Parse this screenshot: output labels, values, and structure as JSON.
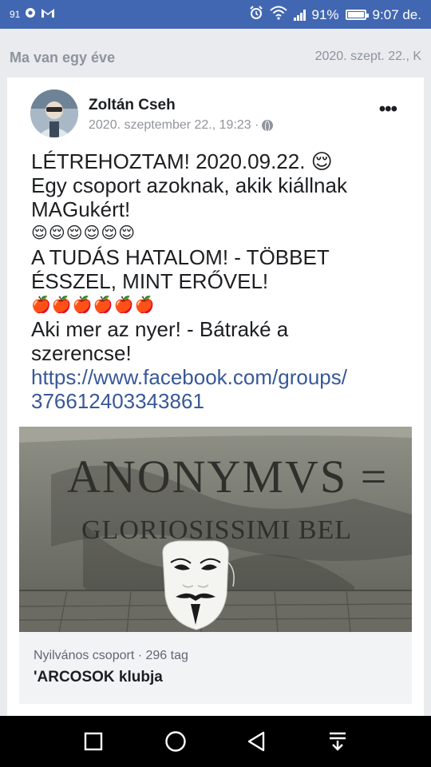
{
  "status_bar": {
    "left_text": "91",
    "battery_percent": "91%",
    "battery_level": 0.91,
    "time": "9:07 de.",
    "icons": [
      "percent-icon",
      "chrome-icon",
      "gmail-icon",
      "alarm-icon",
      "wifi-icon",
      "signal-icon",
      "battery-icon"
    ]
  },
  "memories": {
    "title": "Ma van egy éve",
    "date": "2020. szept. 22., K"
  },
  "post": {
    "author": "Zoltán Cseh",
    "timestamp": "2020. szeptember 22., 19:23 ·",
    "privacy_icon": "globe-icon",
    "lines": [
      "LÉTREHOZTAM! 2020.09.22. 😌",
      "Egy csoport azoknak, akik kiállnak",
      "MAGukért!",
      "😌😌😌😌😌😌",
      "A TUDÁS HATALOM! - TÖBBET",
      "ÉSSZEL, MINT ERŐVEL!",
      "🍎🍎🍎🍎🍎🍎",
      "Aki mer az nyer! - Bátraké a",
      "szerencse!"
    ],
    "link_line1": "https://www.facebook.com/groups/",
    "link_line2": "376612403343861"
  },
  "link_preview": {
    "image_text_line1": "ANONYMVS =",
    "image_text_line2": "GLORIOSISSIMI BEL",
    "subtitle": "Nyilvános csoport · 296 tag",
    "title": "'ARCOSOK klubja"
  },
  "nav": {
    "icons": [
      "recent-apps-icon",
      "home-icon",
      "back-icon",
      "notifications-pull-icon"
    ]
  },
  "colors": {
    "status_bar": "#4267b2",
    "link": "#385898",
    "background": "#e9ebee"
  }
}
